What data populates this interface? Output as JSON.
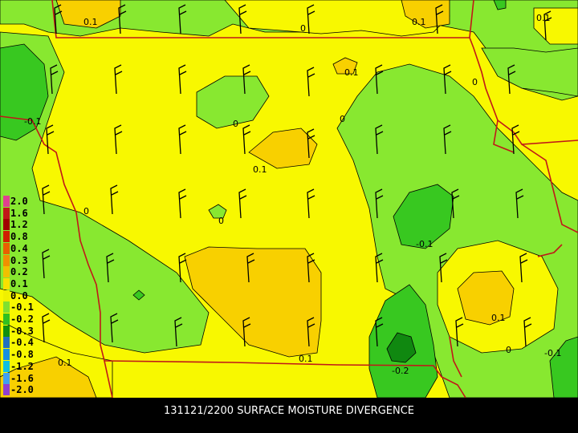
{
  "caption": "131121/2200 SURFACE MOISTURE DIVERGENCE",
  "legend": [
    {
      "label": "2.0",
      "color": "#e04090"
    },
    {
      "label": "1.6",
      "color": "#c01818"
    },
    {
      "label": "1.2",
      "color": "#a00000"
    },
    {
      "label": "0.8",
      "color": "#d02000"
    },
    {
      "label": "0.4",
      "color": "#e86000"
    },
    {
      "label": "0.3",
      "color": "#f09000"
    },
    {
      "label": "0.2",
      "color": "#f0c000"
    },
    {
      "label": "0.1",
      "color": "#f8e000"
    },
    {
      "label": "0.0",
      "color": "#f0f000"
    },
    {
      "label": "-0.1",
      "color": "#80e030"
    },
    {
      "label": "-0.2",
      "color": "#30c020"
    },
    {
      "label": "-0.3",
      "color": "#109010"
    },
    {
      "label": "-0.4",
      "color": "#2070c0"
    },
    {
      "label": "-0.8",
      "color": "#1890e0"
    },
    {
      "label": "-1.2",
      "color": "#10c0e0"
    },
    {
      "label": "-1.6",
      "color": "#40a0f0"
    },
    {
      "label": "-2.0",
      "color": "#9040d0"
    }
  ],
  "contour_labels": [
    "0.1",
    "0",
    "0.1",
    "0",
    "0.1",
    "-0.1",
    "0",
    "0.1",
    "0",
    "0",
    "-0.1",
    "0.1",
    "0.1",
    "0",
    "-0.1",
    "0.1",
    "-0.2",
    "0.1",
    "0"
  ],
  "colors": {
    "pos_01": "#f8f800",
    "pos_02": "#f8d000",
    "neg_01": "#88e830",
    "neg_02": "#38c820",
    "neg_03": "#108810",
    "state_line": "#c01818",
    "background": "#000000"
  }
}
